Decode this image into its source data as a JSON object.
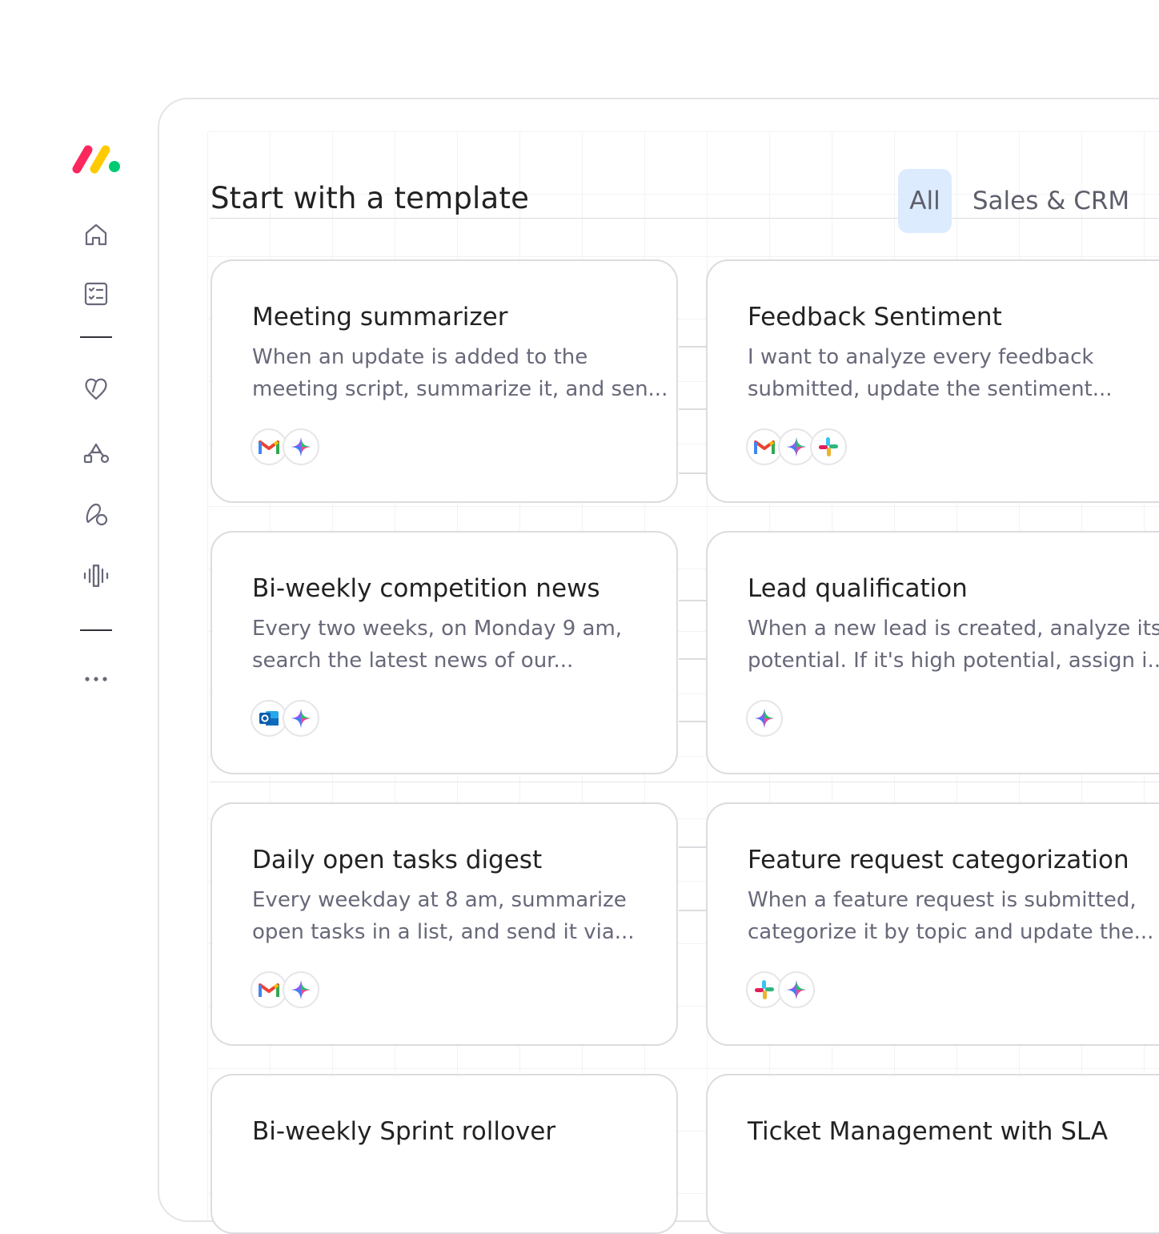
{
  "header": {
    "title": "Start with a template",
    "tabs": [
      {
        "label": "All",
        "active": true
      },
      {
        "label": "Sales & CRM",
        "active": false
      }
    ]
  },
  "sidebar": {
    "icons": [
      "home-icon",
      "tasks-checklist-icon",
      "heart-icon",
      "workflow-shapes-icon",
      "integrations-link-icon",
      "voice-waveform-icon",
      "more-dots-icon"
    ]
  },
  "cards": [
    {
      "title": "Meeting summarizer",
      "desc_line1": "When an update is added to the",
      "desc_line2": "meeting script, summarize it, and sen...",
      "apps": [
        "gmail-icon",
        "ai-sparkle-icon"
      ]
    },
    {
      "title": "Feedback Sentiment",
      "desc_line1": "I want to analyze every feedback",
      "desc_line2": "submitted, update the sentiment...",
      "apps": [
        "gmail-icon",
        "ai-sparkle-icon",
        "slack-icon"
      ]
    },
    {
      "title": "Bi-weekly competition news",
      "desc_line1": "Every two weeks, on Monday 9 am,",
      "desc_line2": "search the latest news of our...",
      "apps": [
        "outlook-icon",
        "ai-sparkle-icon"
      ]
    },
    {
      "title": "Lead qualification",
      "desc_line1": "When a new lead is created, analyze its",
      "desc_line2": "potential. If it's high potential, assign i...",
      "apps": [
        "ai-sparkle-icon"
      ]
    },
    {
      "title": "Daily open tasks digest",
      "desc_line1": "Every weekday at 8 am, summarize",
      "desc_line2": "open tasks in a list, and send it via...",
      "apps": [
        "gmail-icon",
        "ai-sparkle-icon"
      ]
    },
    {
      "title": "Feature request categorization",
      "desc_line1": "When a feature request is submitted,",
      "desc_line2": "categorize it by topic and update the...",
      "apps": [
        "slack-icon",
        "ai-sparkle-icon"
      ]
    },
    {
      "title": "Bi-weekly Sprint rollover",
      "desc_line1": "",
      "desc_line2": "",
      "apps": []
    },
    {
      "title": "Ticket Management with SLA",
      "desc_line1": "",
      "desc_line2": "",
      "apps": []
    }
  ],
  "colors": {
    "logo_red": "#fb275d",
    "logo_yellow": "#ffcb00",
    "logo_green": "#00ca72",
    "tab_active_bg": "#dcebfd",
    "text_primary": "#323338",
    "text_secondary": "#676879"
  }
}
